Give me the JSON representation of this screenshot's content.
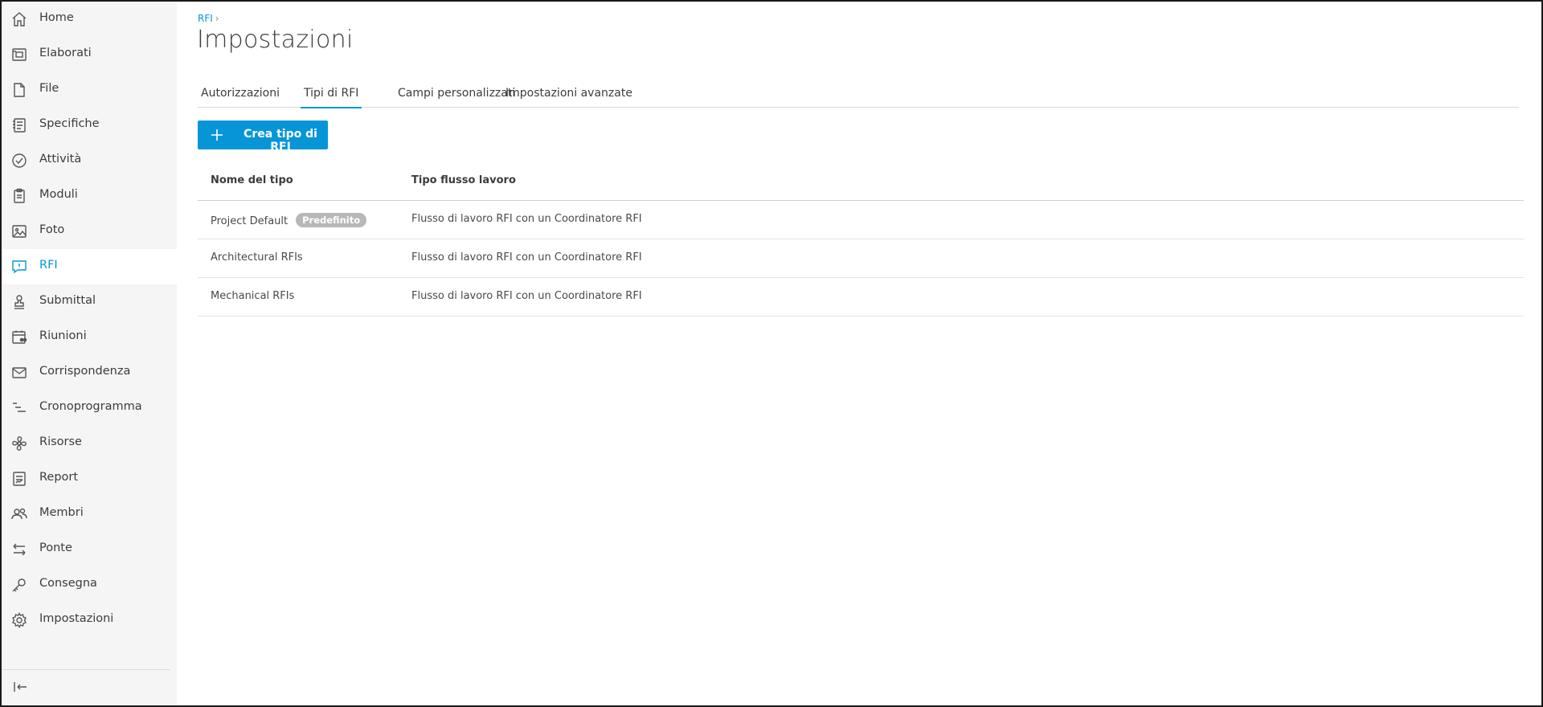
{
  "sidebar": {
    "items": [
      {
        "label": "Home",
        "icon": "home-icon"
      },
      {
        "label": "Elaborati",
        "icon": "sheets-icon"
      },
      {
        "label": "File",
        "icon": "file-icon"
      },
      {
        "label": "Specifiche",
        "icon": "specifications-icon"
      },
      {
        "label": "Attività",
        "icon": "check-circle-icon"
      },
      {
        "label": "Moduli",
        "icon": "clipboard-icon"
      },
      {
        "label": "Foto",
        "icon": "photo-icon"
      },
      {
        "label": "RFI",
        "icon": "rfi-icon",
        "active": true
      },
      {
        "label": "Submittal",
        "icon": "stamp-icon"
      },
      {
        "label": "Riunioni",
        "icon": "calendar-people-icon"
      },
      {
        "label": "Corrispondenza",
        "icon": "mail-icon"
      },
      {
        "label": "Cronoprogramma",
        "icon": "schedule-icon"
      },
      {
        "label": "Risorse",
        "icon": "fan-icon"
      },
      {
        "label": "Report",
        "icon": "report-icon"
      },
      {
        "label": "Membri",
        "icon": "members-icon"
      },
      {
        "label": "Ponte",
        "icon": "bridge-arrows-icon"
      },
      {
        "label": "Consegna",
        "icon": "key-icon"
      },
      {
        "label": "Impostazioni",
        "icon": "gear-icon"
      }
    ],
    "collapse_icon": "collapse-left-icon"
  },
  "breadcrumb": {
    "item": "RFI",
    "separator": "›"
  },
  "page": {
    "title": "Impostazioni"
  },
  "tabs": [
    {
      "label": "Autorizzazioni"
    },
    {
      "label": "Tipi di RFI",
      "active": true
    },
    {
      "label": "Campi personalizzati"
    },
    {
      "label": "Impostazioni avanzate"
    }
  ],
  "create_button": {
    "label": "Crea tipo di RFI",
    "icon": "plus-icon"
  },
  "table": {
    "headers": [
      "Nome del tipo",
      "Tipo flusso lavoro"
    ],
    "rows": [
      {
        "name": "Project Default",
        "badge": "Predefinito",
        "workflow": "Flusso di lavoro RFI con un Coordinatore RFI"
      },
      {
        "name": "Architectural RFIs",
        "workflow": "Flusso di lavoro RFI con un Coordinatore RFI"
      },
      {
        "name": "Mechanical RFIs",
        "workflow": "Flusso di lavoro RFI con un Coordinatore RFI"
      }
    ]
  },
  "colors": {
    "accent": "#0696d7",
    "sidebar_bg": "#f5f5f5",
    "badge_bg": "#b8b8b8"
  }
}
